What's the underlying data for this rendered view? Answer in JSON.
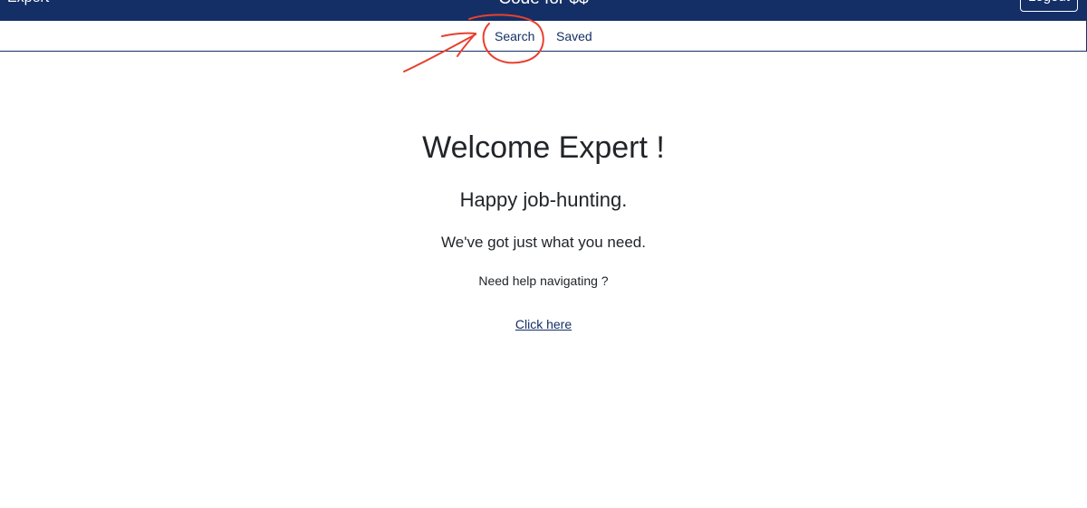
{
  "header": {
    "user_label": "Expert",
    "brand_title": "Code for $$",
    "logout_label": "Logout"
  },
  "subnav": {
    "items": [
      {
        "label": "Search"
      },
      {
        "label": "Saved"
      }
    ]
  },
  "main": {
    "welcome_title": "Welcome Expert !",
    "happy_text": "Happy job-hunting.",
    "need_text": "We've got just what you need.",
    "help_text": "Need help navigating ?",
    "help_link": "Click here"
  },
  "colors": {
    "header_bg": "#142f66",
    "nav_text": "#142f66",
    "annotation": "#e8402e"
  }
}
